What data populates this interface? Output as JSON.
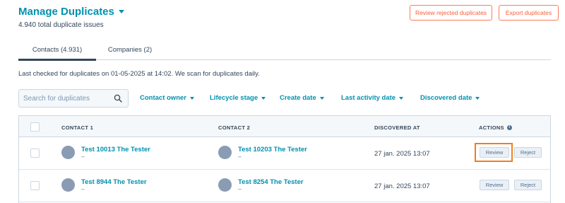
{
  "header": {
    "title": "Manage Duplicates",
    "subtitle": "4.940 total duplicate issues",
    "review_rejected_label": "Review rejected duplicates",
    "export_label": "Export duplicates"
  },
  "tabs": [
    {
      "label": "Contacts (4.931)",
      "active": true
    },
    {
      "label": "Companies (2)",
      "active": false
    }
  ],
  "info_line": "Last checked for duplicates on 01-05-2025 at 14:02. We scan for duplicates daily.",
  "search": {
    "placeholder": "Search for duplicates",
    "value": ""
  },
  "filters": [
    "Contact owner",
    "Lifecycle stage",
    "Create date",
    "Last activity date",
    "Discovered date"
  ],
  "table": {
    "columns": [
      "CONTACT 1",
      "CONTACT 2",
      "DISCOVERED AT",
      "ACTIONS"
    ],
    "rows": [
      {
        "contact1": "Test 10013 The Tester",
        "contact1_sub": "--",
        "contact2": "Test 10203 The Tester",
        "contact2_sub": "--",
        "discovered": "27 jan. 2025 13:07",
        "review": "Review",
        "reject": "Reject"
      },
      {
        "contact1": "Test 8944 The Tester",
        "contact1_sub": "--",
        "contact2": "Test 8254 The Tester",
        "contact2_sub": "--",
        "discovered": "27 jan. 2025 13:07",
        "review": "Review",
        "reject": "Reject"
      }
    ]
  },
  "icons": {
    "search": "search-icon",
    "info": "info-icon",
    "caret": "chevron-down-icon"
  },
  "colors": {
    "brand": "#0091ae",
    "accent": "#ff7a59",
    "highlight": "#f07f1f",
    "text": "#33475b"
  }
}
